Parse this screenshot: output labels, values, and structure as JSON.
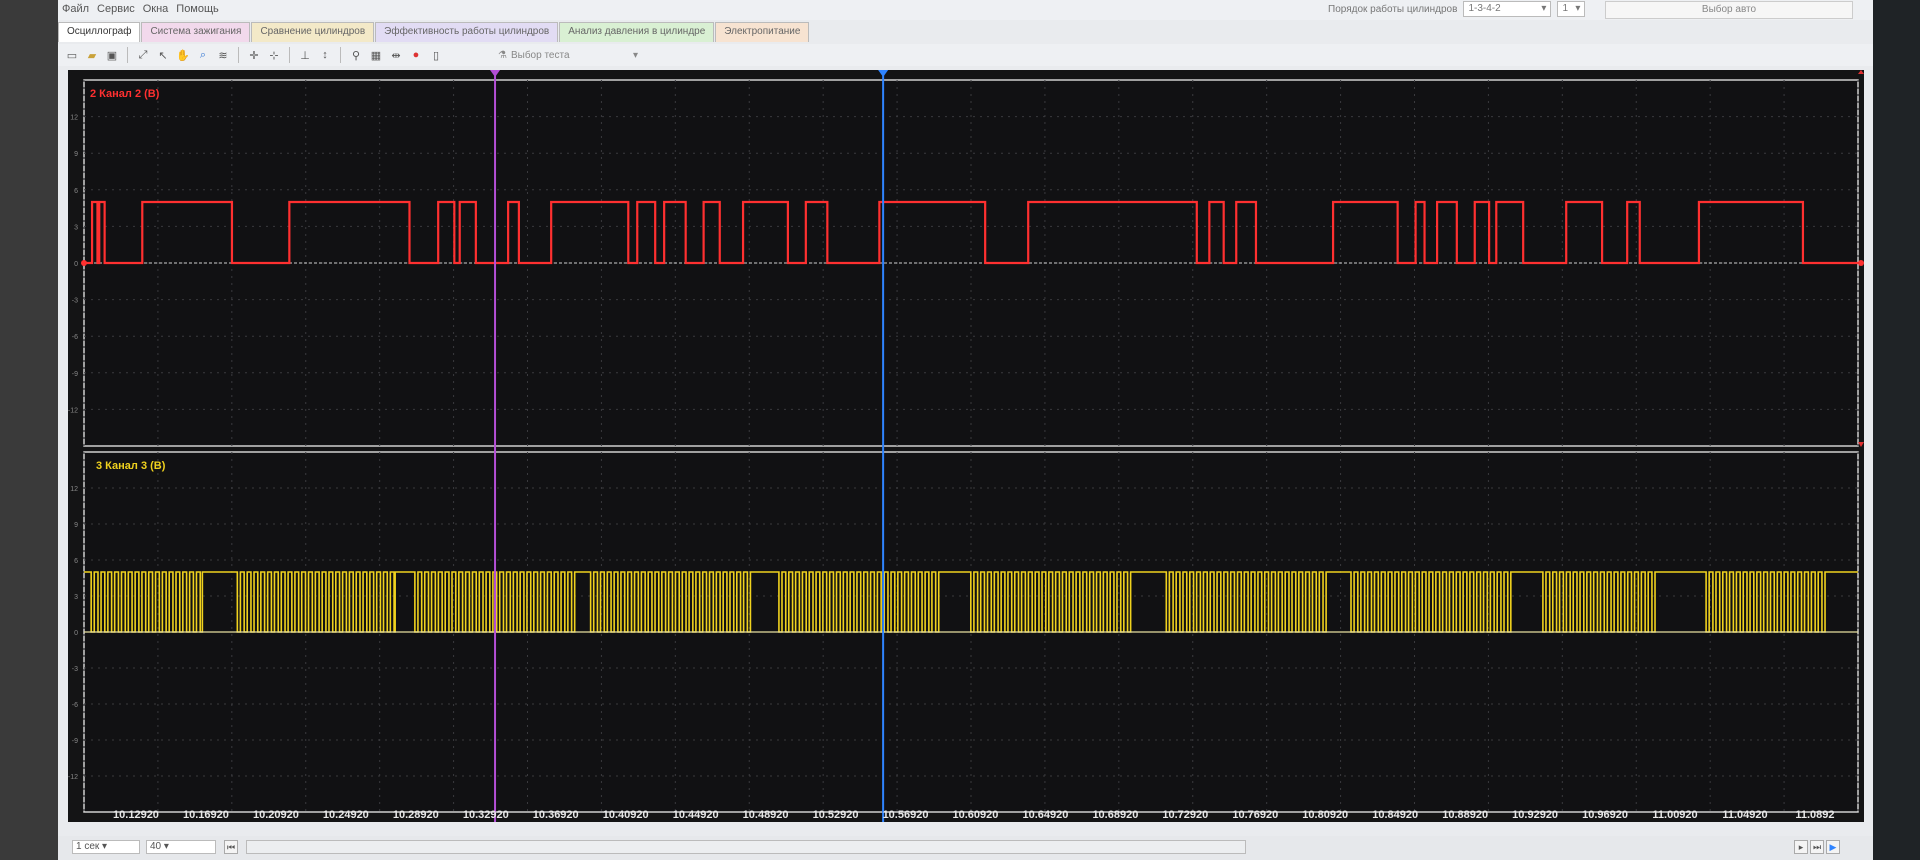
{
  "menu": [
    "Файл",
    "Сервис",
    "Окна",
    "Помощь"
  ],
  "header": {
    "firing_order_label": "Порядок работы цилиндров",
    "firing_order_value": "1-3-4-2",
    "cylinder_value": "1",
    "car_select_label": "Выбор авто"
  },
  "tabs": [
    {
      "label": "Осциллограф",
      "active": true,
      "color": "#ffffff"
    },
    {
      "label": "Система зажигания",
      "active": false,
      "color": "#f2d9ec"
    },
    {
      "label": "Сравнение цилиндров",
      "active": false,
      "color": "#f3e9c8"
    },
    {
      "label": "Эффективность работы цилиндров",
      "active": false,
      "color": "#e2dcf4"
    },
    {
      "label": "Анализ давления в цилиндре",
      "active": false,
      "color": "#d9f0d3"
    },
    {
      "label": "Электропитание",
      "active": false,
      "color": "#f7e3d1"
    }
  ],
  "toolbar": {
    "icons": [
      "new-file-icon",
      "open-folder-icon",
      "save-icon",
      "fit-icon",
      "cursor-icon",
      "hand-pan-icon",
      "zoom-icon",
      "autoscale-icon",
      "cross-cursor-icon",
      "center-icon",
      "measure-icon",
      "marker-icon",
      "filter-icon",
      "table-icon",
      "split-icon",
      "record-icon",
      "page-icon"
    ],
    "test_select_label": "Выбор теста"
  },
  "channels": [
    {
      "id": "ch2",
      "label": "2 Канал 2 (В)",
      "color": "#ff3030"
    },
    {
      "id": "ch3",
      "label": "3 Канал 3 (В)",
      "color": "#f0d21e"
    }
  ],
  "y_ticks": [
    "12",
    "9",
    "6",
    "3",
    "0",
    "-3",
    "-6",
    "-9",
    "-12"
  ],
  "x_ticks": [
    "10.12920",
    "10.16920",
    "10.20920",
    "10.24920",
    "10.28920",
    "10.32920",
    "10.36920",
    "10.40920",
    "10.44920",
    "10.48920",
    "10.52920",
    "10.56920",
    "10.60920",
    "10.64920",
    "10.68920",
    "10.72920",
    "10.76920",
    "10.80920",
    "10.84920",
    "10.88920",
    "10.92920",
    "10.96920",
    "11.00920",
    "11.04920",
    "11.0892"
  ],
  "cursors": [
    {
      "name": "cursor-purple",
      "time": 10.3292,
      "color": "#b44fd6"
    },
    {
      "name": "cursor-blue",
      "time": 10.5456,
      "color": "#2f84ff"
    }
  ],
  "status": {
    "timebase": "1 сек",
    "divisions": "40"
  },
  "chart_data": [
    {
      "type": "line",
      "title": "2 Канал 2 (В)",
      "ylabel": "",
      "ylim": [
        -15,
        15
      ],
      "xlim": [
        10.1,
        11.0892
      ],
      "series": [
        {
          "name": "2 Канал 2 (В)",
          "high": 5,
          "low": 0,
          "pulses": [
            [
              10.1045,
              10.1075
            ],
            [
              10.1085,
              10.1115
            ],
            [
              10.1325,
              10.1825
            ],
            [
              10.2145,
              10.2815
            ],
            [
              10.2975,
              10.3065
            ],
            [
              10.3095,
              10.3185
            ],
            [
              10.3365,
              10.3425
            ],
            [
              10.3605,
              10.4035
            ],
            [
              10.4085,
              10.4185
            ],
            [
              10.4235,
              10.4355
            ],
            [
              10.4455,
              10.4545
            ],
            [
              10.4675,
              10.4925
            ],
            [
              10.5025,
              10.5145
            ],
            [
              10.5435,
              10.6025
            ],
            [
              10.6265,
              10.7205
            ],
            [
              10.7275,
              10.7355
            ],
            [
              10.7425,
              10.7535
            ],
            [
              10.7965,
              10.8325
            ],
            [
              10.8425,
              10.8475
            ],
            [
              10.8545,
              10.8655
            ],
            [
              10.8755,
              10.8835
            ],
            [
              10.8875,
              10.9025
            ],
            [
              10.9265,
              10.9465
            ],
            [
              10.9605,
              10.9675
            ],
            [
              11.0005,
              11.0585
            ]
          ]
        }
      ]
    },
    {
      "type": "line",
      "title": "3 Канал 3 (В)",
      "ylabel": "",
      "ylim": [
        -15,
        15
      ],
      "xlim": [
        10.1,
        11.0892
      ],
      "series": [
        {
          "name": "3 Канал 3 (В)",
          "high": 5,
          "low": 0,
          "pulse_trains": [
            [
              10.104,
              10.166
            ],
            [
              10.1855,
              10.2735
            ],
            [
              10.2845,
              10.3745
            ],
            [
              10.3825,
              10.4725
            ],
            [
              10.4875,
              10.5775
            ],
            [
              10.5945,
              10.6855
            ],
            [
              10.7035,
              10.7945
            ],
            [
              10.8065,
              10.8965
            ],
            [
              10.9135,
              10.9765
            ],
            [
              11.0045,
              11.0725
            ]
          ],
          "train_pulse_period": 0.0038
        }
      ]
    }
  ]
}
